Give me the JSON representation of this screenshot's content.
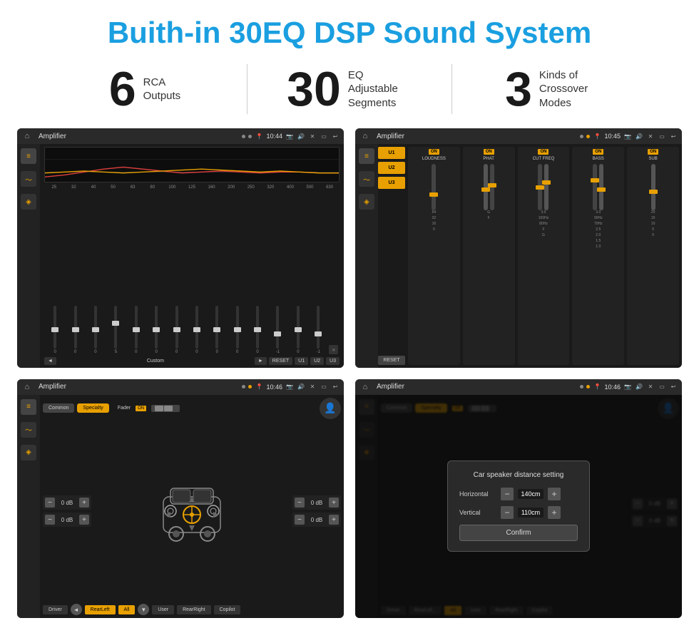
{
  "header": {
    "title": "Buith-in 30EQ DSP Sound System"
  },
  "stats": [
    {
      "number": "6",
      "label": "RCA\nOutputs"
    },
    {
      "number": "30",
      "label": "EQ Adjustable\nSegments"
    },
    {
      "number": "3",
      "label": "Kinds of\nCrossover Modes"
    }
  ],
  "screens": {
    "eq": {
      "title": "Amplifier",
      "time": "10:44",
      "freq_labels": [
        "25",
        "32",
        "40",
        "50",
        "63",
        "80",
        "100",
        "125",
        "160",
        "200",
        "250",
        "320",
        "400",
        "500",
        "630"
      ],
      "slider_values": [
        "0",
        "0",
        "0",
        "5",
        "0",
        "0",
        "0",
        "0",
        "0",
        "0",
        "0",
        "-1",
        "0",
        "-1"
      ],
      "buttons": {
        "prev": "◄",
        "label": "Custom",
        "play": "►",
        "reset": "RESET",
        "u1": "U1",
        "u2": "U2",
        "u3": "U3",
        "next": "»"
      }
    },
    "amplifier": {
      "title": "Amplifier",
      "time": "10:45",
      "presets": [
        "U1",
        "U2",
        "U3"
      ],
      "reset": "RESET",
      "columns": [
        {
          "label": "LOUDNESS",
          "on": true
        },
        {
          "label": "PHAT",
          "on": true
        },
        {
          "label": "CUT FREQ",
          "on": true
        },
        {
          "label": "BASS",
          "on": true
        },
        {
          "label": "SUB",
          "on": true
        }
      ]
    },
    "crossover": {
      "title": "Amplifier",
      "time": "10:46",
      "tabs": [
        "Common",
        "Specialty"
      ],
      "fader_label": "Fader",
      "on_badge": "ON",
      "db_values": [
        "0 dB",
        "0 dB",
        "0 dB",
        "0 dB"
      ],
      "buttons": {
        "driver": "Driver",
        "rear_left": "RearLeft",
        "all": "All",
        "user": "User",
        "rear_right": "RearRight",
        "copilot": "Copilot"
      }
    },
    "distance": {
      "title": "Amplifier",
      "time": "10:46",
      "tabs": [
        "Common",
        "Specialty"
      ],
      "on_badge": "ON",
      "dialog": {
        "title": "Car speaker distance setting",
        "horizontal_label": "Horizontal",
        "horizontal_value": "140cm",
        "vertical_label": "Vertical",
        "vertical_value": "110cm",
        "confirm_label": "Confirm"
      },
      "right_db_values": [
        "0 dB",
        "0 dB"
      ],
      "buttons": {
        "driver": "Driver",
        "rear_left": "RearLef...",
        "all": "All",
        "user": "User",
        "rear_right": "RearRight",
        "copilot": "Copilot"
      }
    }
  }
}
